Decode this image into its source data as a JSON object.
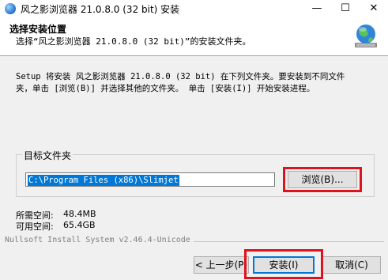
{
  "window": {
    "title": "风之影浏览器 21.0.8.0 (32 bit) 安装",
    "minimize_glyph": "—",
    "maximize_glyph": "☐",
    "close_glyph": "✕"
  },
  "header": {
    "title": "选择安装位置",
    "subtitle": "选择“风之影浏览器 21.0.8.0 (32 bit)”的安装文件夹。",
    "logo_icon": "globe-network-icon"
  },
  "description": "Setup 将安装 风之影浏览器 21.0.8.0 (32 bit) 在下列文件夹。要安装到不同文件\n夹，单击 [浏览(B)] 并选择其他的文件夹。 单击 [安装(I)] 开始安装进程。",
  "destination": {
    "group_label": "目标文件夹",
    "path_value": "C:\\Program Files (x86)\\Slimjet",
    "browse_label": "浏览(B)..."
  },
  "space": {
    "required_label": "所需空间:",
    "required_value": "48.4MB",
    "available_label": "可用空间:",
    "available_value": "65.4GB"
  },
  "footer": {
    "brand": "Nullsoft Install System v2.46.4-Unicode",
    "back_label": "< 上一步(P)",
    "install_label": "安装(I)",
    "cancel_label": "取消(C)"
  },
  "colors": {
    "highlight": "#e0121b",
    "selection": "#0078d7"
  }
}
